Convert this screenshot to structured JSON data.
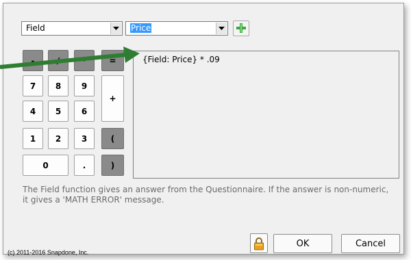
{
  "field_type_select": {
    "value": "Field"
  },
  "field_name_select": {
    "value": "Price"
  },
  "add_button_icon": "plus-icon",
  "keypad": {
    "row1": [
      "-",
      "/",
      "*",
      "="
    ],
    "digits": [
      "7",
      "8",
      "9",
      "4",
      "5",
      "6",
      "1",
      "2",
      "3",
      "0"
    ],
    "plus": "+",
    "open_paren": "(",
    "close_paren": ")",
    "dot": "."
  },
  "formula": "{Field: Price} * .09",
  "help_text": "The Field function gives an answer from the Questionnaire.  If the answer is non-numeric, it gives a 'MATH ERROR' message.",
  "copyright": "(c) 2011-2016 Snapdone, Inc.",
  "buttons": {
    "lock_icon": "lock-icon",
    "ok": "OK",
    "cancel": "Cancel"
  },
  "colors": {
    "accent_green": "#2e7d32",
    "selection_blue": "#3399ff",
    "dark_key": "#8a8a8a"
  }
}
